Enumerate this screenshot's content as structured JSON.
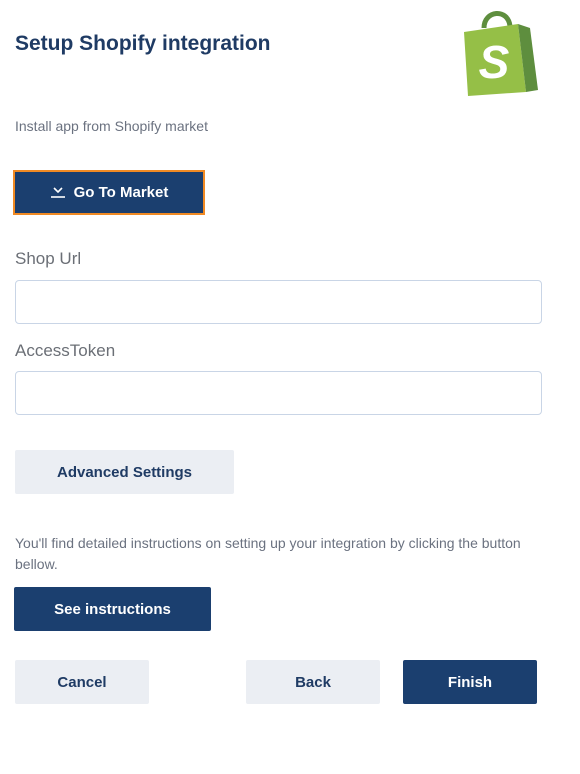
{
  "header": {
    "title": "Setup Shopify integration",
    "logo_icon": "shopify-bag-icon",
    "logo_letter": "S"
  },
  "install": {
    "text": "Install app from Shopify market",
    "button_label": "Go To Market",
    "button_icon": "download-icon"
  },
  "fields": {
    "shop_url": {
      "label": "Shop Url",
      "value": "",
      "placeholder": ""
    },
    "access_token": {
      "label": "AccessToken",
      "value": "",
      "placeholder": ""
    }
  },
  "advanced_label": "Advanced Settings",
  "instructions": {
    "text": "You'll find detailed instructions on setting up your integration by clicking the button bellow.",
    "button_label": "See instructions"
  },
  "footer": {
    "cancel_label": "Cancel",
    "back_label": "Back",
    "finish_label": "Finish"
  },
  "colors": {
    "primary": "#1b3f6f",
    "focus_outline": "#f08a24",
    "secondary_button": "#ebeef3",
    "shopify_green": "#95bf47"
  }
}
